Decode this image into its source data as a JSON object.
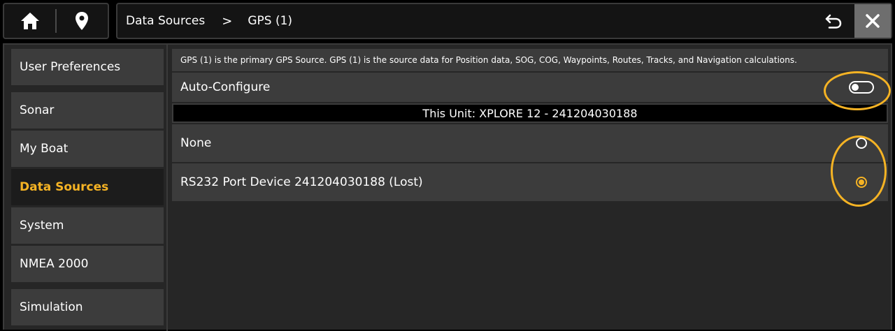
{
  "header": {
    "icons": {
      "home": "home-icon",
      "location": "location-pin-icon",
      "back": "back-icon",
      "close": "close-icon"
    },
    "breadcrumb": [
      "Data Sources",
      "GPS (1)"
    ],
    "separator": ">"
  },
  "sidebar": {
    "items": [
      {
        "label": "User Preferences",
        "active": false
      },
      {
        "label": "Sonar",
        "active": false
      },
      {
        "label": "My Boat",
        "active": false
      },
      {
        "label": "Data Sources",
        "active": true
      },
      {
        "label": "System",
        "active": false
      },
      {
        "label": "NMEA 2000",
        "active": false
      },
      {
        "label": "Simulation",
        "active": false
      }
    ]
  },
  "main": {
    "info_text": "GPS (1) is the primary GPS Source. GPS (1) is the source data for Position data, SOG, COG, Waypoints, Routes, Tracks, and Navigation calculations.",
    "auto_configure": {
      "label": "Auto-Configure",
      "enabled": false
    },
    "unit_label": "This Unit: XPLORE 12 - 241204030188",
    "sources": [
      {
        "label": "None",
        "selected": false
      },
      {
        "label": "RS232 Port Device 241204030188  (Lost)",
        "selected": true
      }
    ]
  },
  "colors": {
    "accent": "#f5b324",
    "panel": "#3c3c3c",
    "background": "#262626"
  }
}
